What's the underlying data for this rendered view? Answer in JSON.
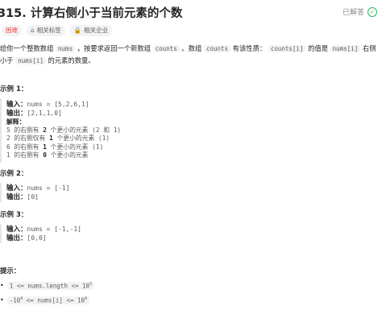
{
  "title": "315. 计算右侧小于当前元素的个数",
  "status": "已解答",
  "tags": {
    "difficulty": "困难",
    "topics": "相关标签",
    "companies": "相关企业"
  },
  "description": {
    "p1": "给你一个整数数组",
    "nums": "nums",
    "p2": "，按要求返回一个新数组",
    "counts": "counts",
    "p3": "。数组",
    "counts2": "counts",
    "p4": "有该性质：",
    "counts_i": "counts[i]",
    "p5": "的值是",
    "nums_i": "nums[i]",
    "p6": "右侧小于",
    "nums_i2": "nums[i]",
    "p7": "的元素的数量。"
  },
  "examples": [
    {
      "heading": "示例 1：",
      "input_label": "输入：",
      "input": "nums = [5,2,6,1]",
      "output_label": "输出：",
      "output": "[2,1,1,0]",
      "explain_label": "解释：",
      "explanation": [
        {
          "pre": "5 的右侧有 ",
          "num": "2",
          "post": " 个更小的元素 (2 和 1)"
        },
        {
          "pre": "2 的右侧仅有 ",
          "num": "1",
          "post": " 个更小的元素 (1)"
        },
        {
          "pre": "6 的右侧有 ",
          "num": "1",
          "post": " 个更小的元素 (1)"
        },
        {
          "pre": "1 的右侧有 ",
          "num": "0",
          "post": " 个更小的元素"
        }
      ]
    },
    {
      "heading": "示例 2：",
      "input_label": "输入：",
      "input": "nums = [-1]",
      "output_label": "输出：",
      "output": "[0]"
    },
    {
      "heading": "示例 3：",
      "input_label": "输入：",
      "input": "nums = [-1,-1]",
      "output_label": "输出：",
      "output": "[0,0]"
    }
  ],
  "constraints": {
    "heading": "提示：",
    "c1_base": "1 <= nums.length <= 10",
    "c1_exp": "5",
    "c2_a": "-10",
    "c2_a_exp": "4",
    "c2_mid": " <= nums[i] <= 10",
    "c2_b_exp": "4"
  },
  "colors": {
    "hard": "#ef4743",
    "solved": "#2db55d",
    "text": "#262626",
    "code_bg": "#f2f3f4"
  },
  "icons": [
    "check-circle-icon",
    "tag-icon",
    "lock-icon",
    "bullet-icon"
  ]
}
